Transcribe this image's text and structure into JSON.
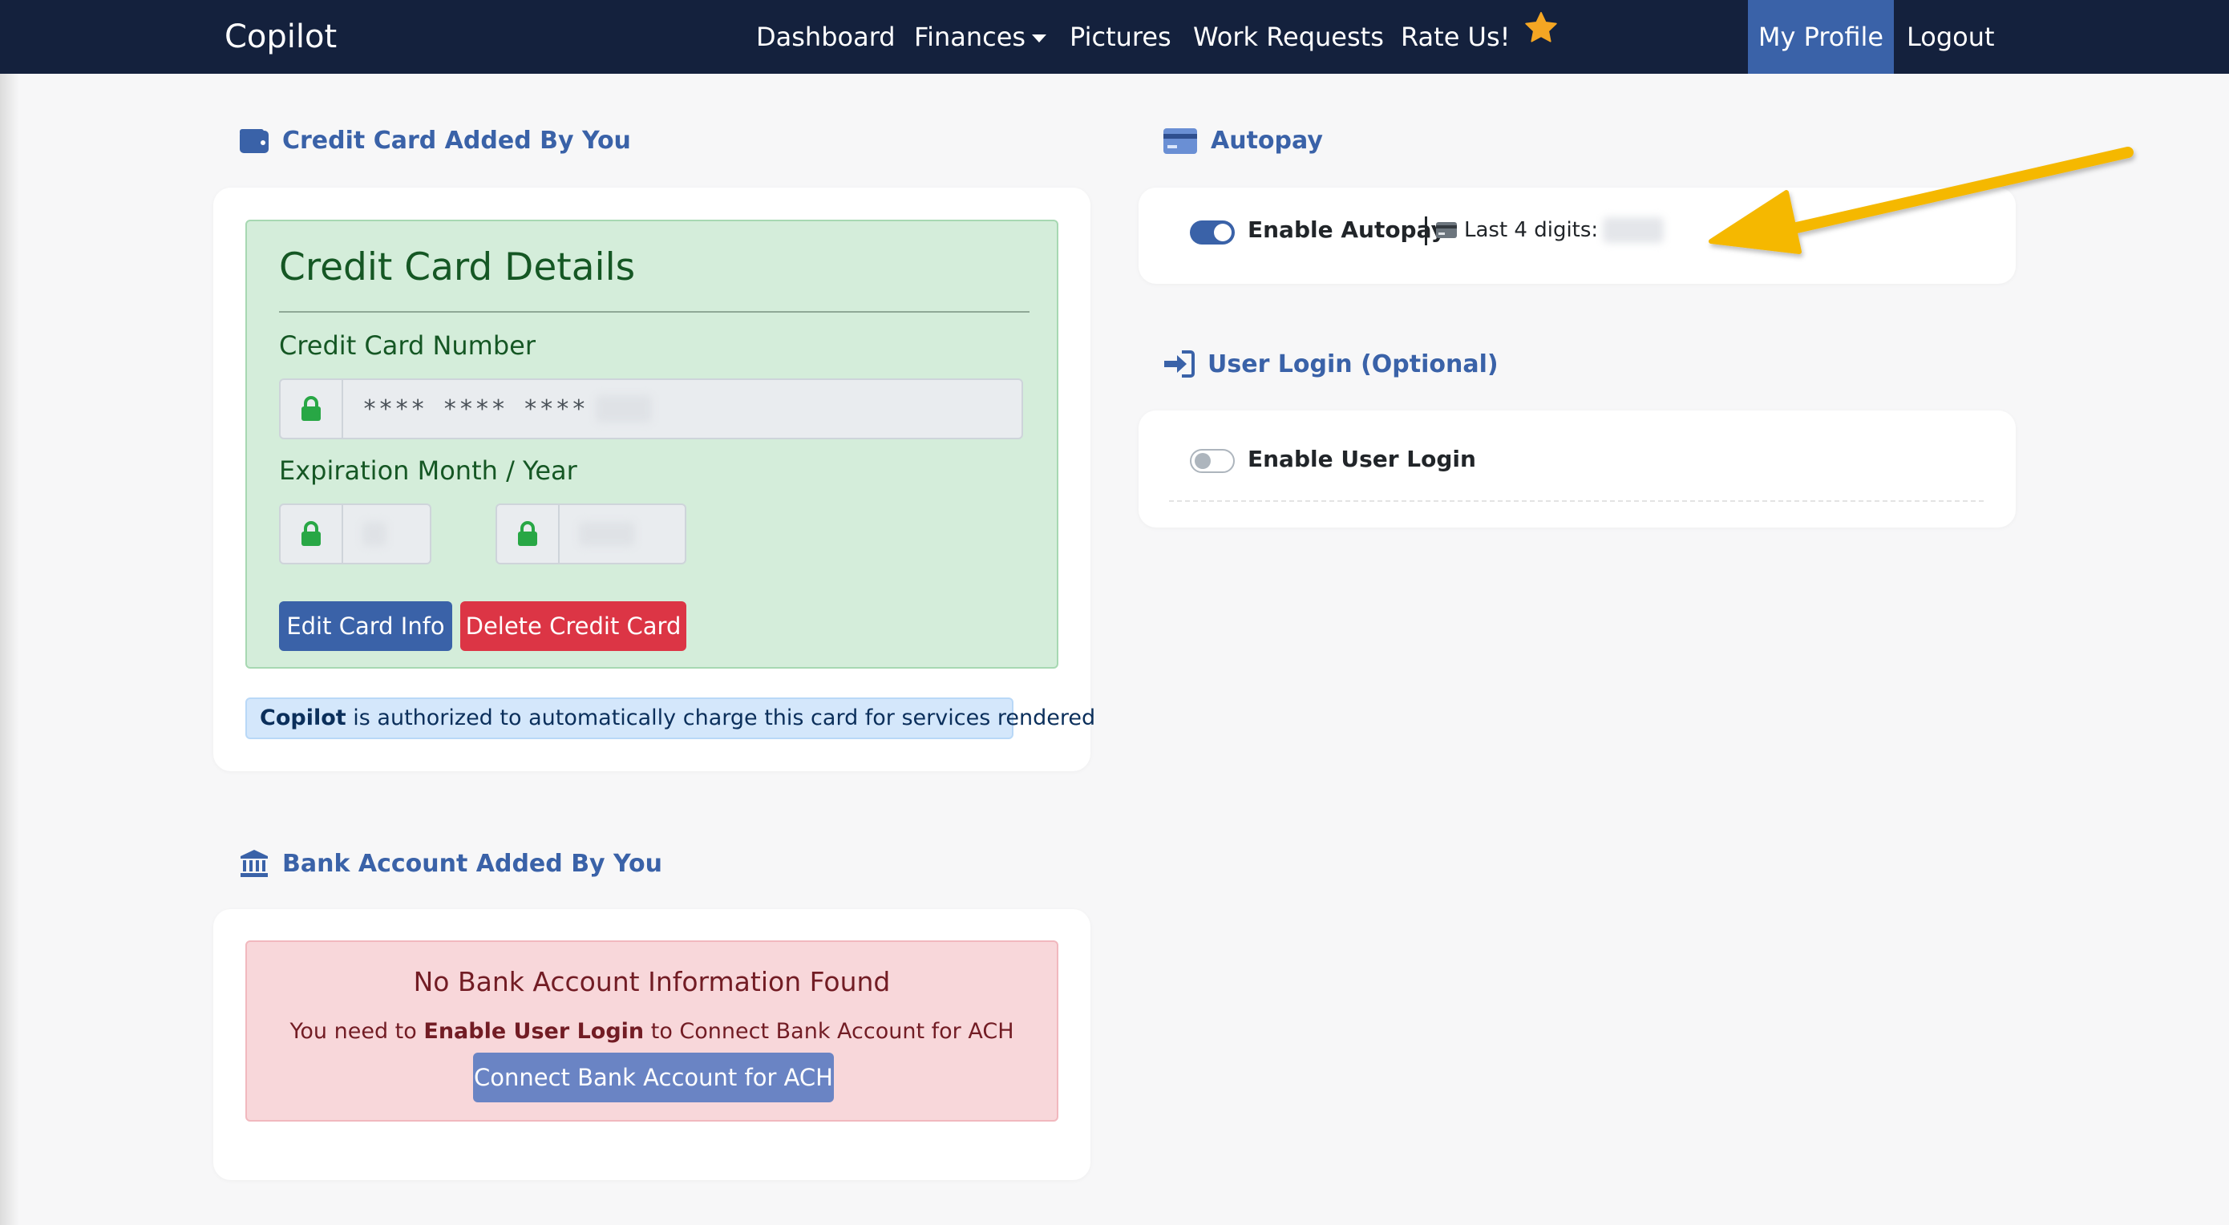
{
  "navbar": {
    "brand": "Copilot",
    "items": {
      "dashboard": "Dashboard",
      "finances": "Finances",
      "pictures": "Pictures",
      "work_requests": "Work Requests",
      "rate_us": "Rate Us!",
      "my_profile": "My Profile",
      "logout": "Logout"
    }
  },
  "credit_card_section": {
    "header": "Credit Card Added By You",
    "details_title": "Credit Card Details",
    "number_label": "Credit Card Number",
    "number_masked": "**** **** ****",
    "expiration_label": "Expiration Month / Year",
    "edit_button": "Edit Card Info",
    "delete_button": "Delete Credit Card",
    "authorization": {
      "company": "Copilot",
      "text": "is authorized to automatically charge this card for services rendered"
    }
  },
  "bank_section": {
    "header": "Bank Account Added By You",
    "empty_title": "No Bank Account Information Found",
    "text_prefix": "You need to",
    "text_bold": "Enable User Login",
    "text_suffix": "to Connect Bank Account for ACH",
    "connect_button": "Connect Bank Account for ACH"
  },
  "autopay_section": {
    "header": "Autopay",
    "toggle_label": "Enable Autopay",
    "toggle_on": true,
    "last4_label": "Last 4 digits:"
  },
  "user_login_section": {
    "header": "User Login (Optional)",
    "toggle_label": "Enable User Login",
    "toggle_on": false
  },
  "colors": {
    "navbar": "#14213d",
    "accent": "#3a62a8",
    "success_bg": "#d4edda",
    "danger_bg": "#f8d7da",
    "annotation_arrow": "#f5b800"
  }
}
